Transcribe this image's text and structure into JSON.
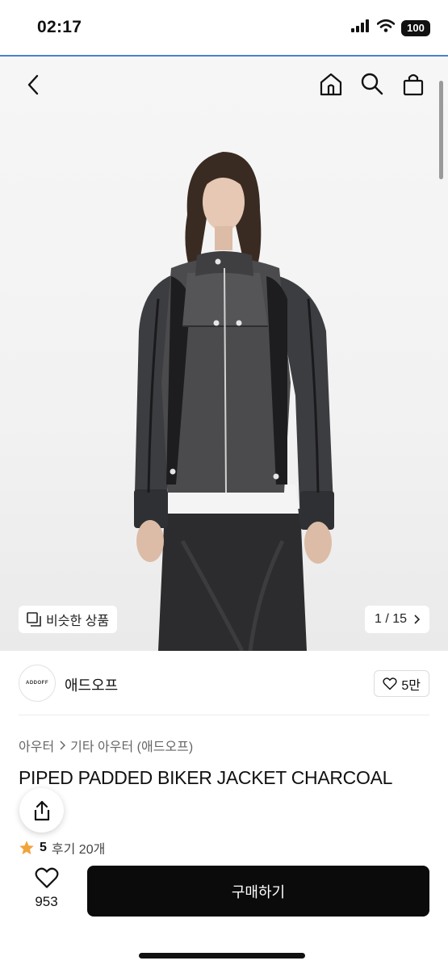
{
  "status": {
    "time": "02:17",
    "battery": "100"
  },
  "gallery": {
    "similar_label": "비슷한 상품",
    "counter": "1 / 15"
  },
  "shop": {
    "logo_text": "ADDOFF",
    "name": "애드오프",
    "likes": "5만"
  },
  "breadcrumb": {
    "level1": "아우터",
    "level2": "기타 아우터 (애드오프)"
  },
  "product": {
    "title": "PIPED PADDED BIKER JACKET CHARCOAL"
  },
  "rating": {
    "score": "5",
    "reviews": "후기 20개"
  },
  "bottom": {
    "wish_count": "953",
    "buy_label": "구매하기"
  },
  "icons": [
    "back-icon",
    "home-icon",
    "search-icon",
    "shopping-bag-icon",
    "similar-icon",
    "chevron-right-icon",
    "heart-icon",
    "share-icon",
    "star-icon",
    "signal-icon",
    "wifi-icon"
  ]
}
